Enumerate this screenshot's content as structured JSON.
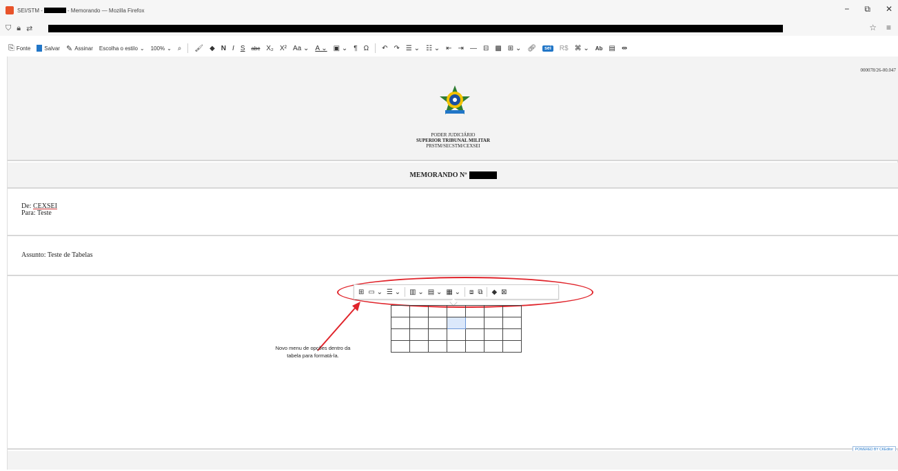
{
  "window": {
    "title_prefix": "SEI/STM -",
    "title_suffix": "- Memorando — Mozilla Firefox",
    "controls": [
      "−",
      "⧉",
      "✕"
    ]
  },
  "urlbar": {
    "icons": [
      "shield-icon",
      "lock-icon",
      "permissions-icon"
    ],
    "right_icons": [
      "☆",
      "≡"
    ]
  },
  "toolbar": {
    "fonte": "Fonte",
    "salvar": "Salvar",
    "assinar": "Assinar",
    "style_select": "Escolha o estilo",
    "zoom": "100%",
    "bold": "N",
    "italic": "I",
    "underline": "S",
    "strike": "abc",
    "subscript": "X₂",
    "superscript": "X²",
    "case": "Aa",
    "font_color": "A",
    "pilcrow": "¶",
    "omega": "Ω",
    "sei": "sei",
    "currency": "R$",
    "abbr": "Ab"
  },
  "document": {
    "protocol": "000078/26-00.047",
    "org_line1": "PODER JUDICIÁRIO",
    "org_line2": "SUPERIOR TRIBUNAL MILITAR",
    "org_line3": "PRSTM/SECSTM/CEXSEI",
    "memo_title": "MEMORANDO Nº",
    "from_label": "De:",
    "from_value": "CEXSEI",
    "to_label": "Para:",
    "to_value": "Teste",
    "subject_label": "Assunto:",
    "subject_value": "Teste de Tabelas",
    "annotation": "Novo menu de opções dentro da tabela para formatá-la.",
    "ck_badge": "POWERED BY CKEditor"
  },
  "table": {
    "rows": 4,
    "cols": 7,
    "selected_row": 1,
    "selected_col": 3
  },
  "colors": {
    "annotation": "#e0242b",
    "accent": "#2176c7"
  }
}
